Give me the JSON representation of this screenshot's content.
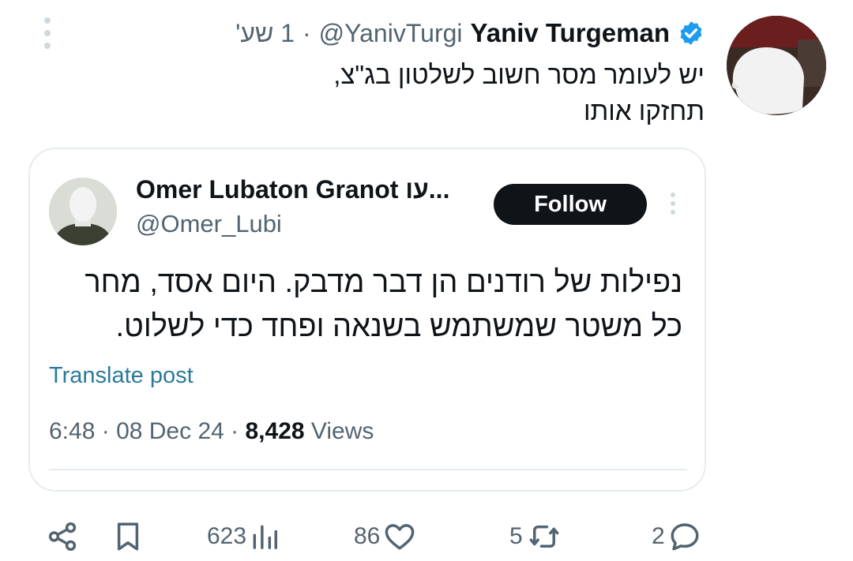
{
  "tweet": {
    "time": "1 שע'",
    "separator": "·",
    "handle": "@YanivTurgi",
    "author": "Yaniv Turgeman",
    "body_line1": "יש לעומר מסר חשוב לשלטון בג\"צ,",
    "body_line2": "תחזקו אותו"
  },
  "quoted": {
    "author": "Omer Lubaton Granot עו...",
    "handle": "@Omer_Lubi",
    "follow_label": "Follow",
    "text_line1": "נפילות של רודנים הן דבר מדבק. היום אסד, מחר",
    "text_line2": "כל משטר שמשתמש בשנאה ופחד כדי לשלוט.",
    "translate_label": "Translate post",
    "time": "6:48",
    "date": "08 Dec 24",
    "sep": " · ",
    "views_count": "8,428",
    "views_label": "Views"
  },
  "actions": {
    "views": "623",
    "likes": "86",
    "retweets": "5",
    "replies": "2"
  },
  "colors": {
    "verified": "#1d9bf0",
    "muted": "#536471",
    "link": "#2b7a9b",
    "button_bg": "#0f1419"
  }
}
